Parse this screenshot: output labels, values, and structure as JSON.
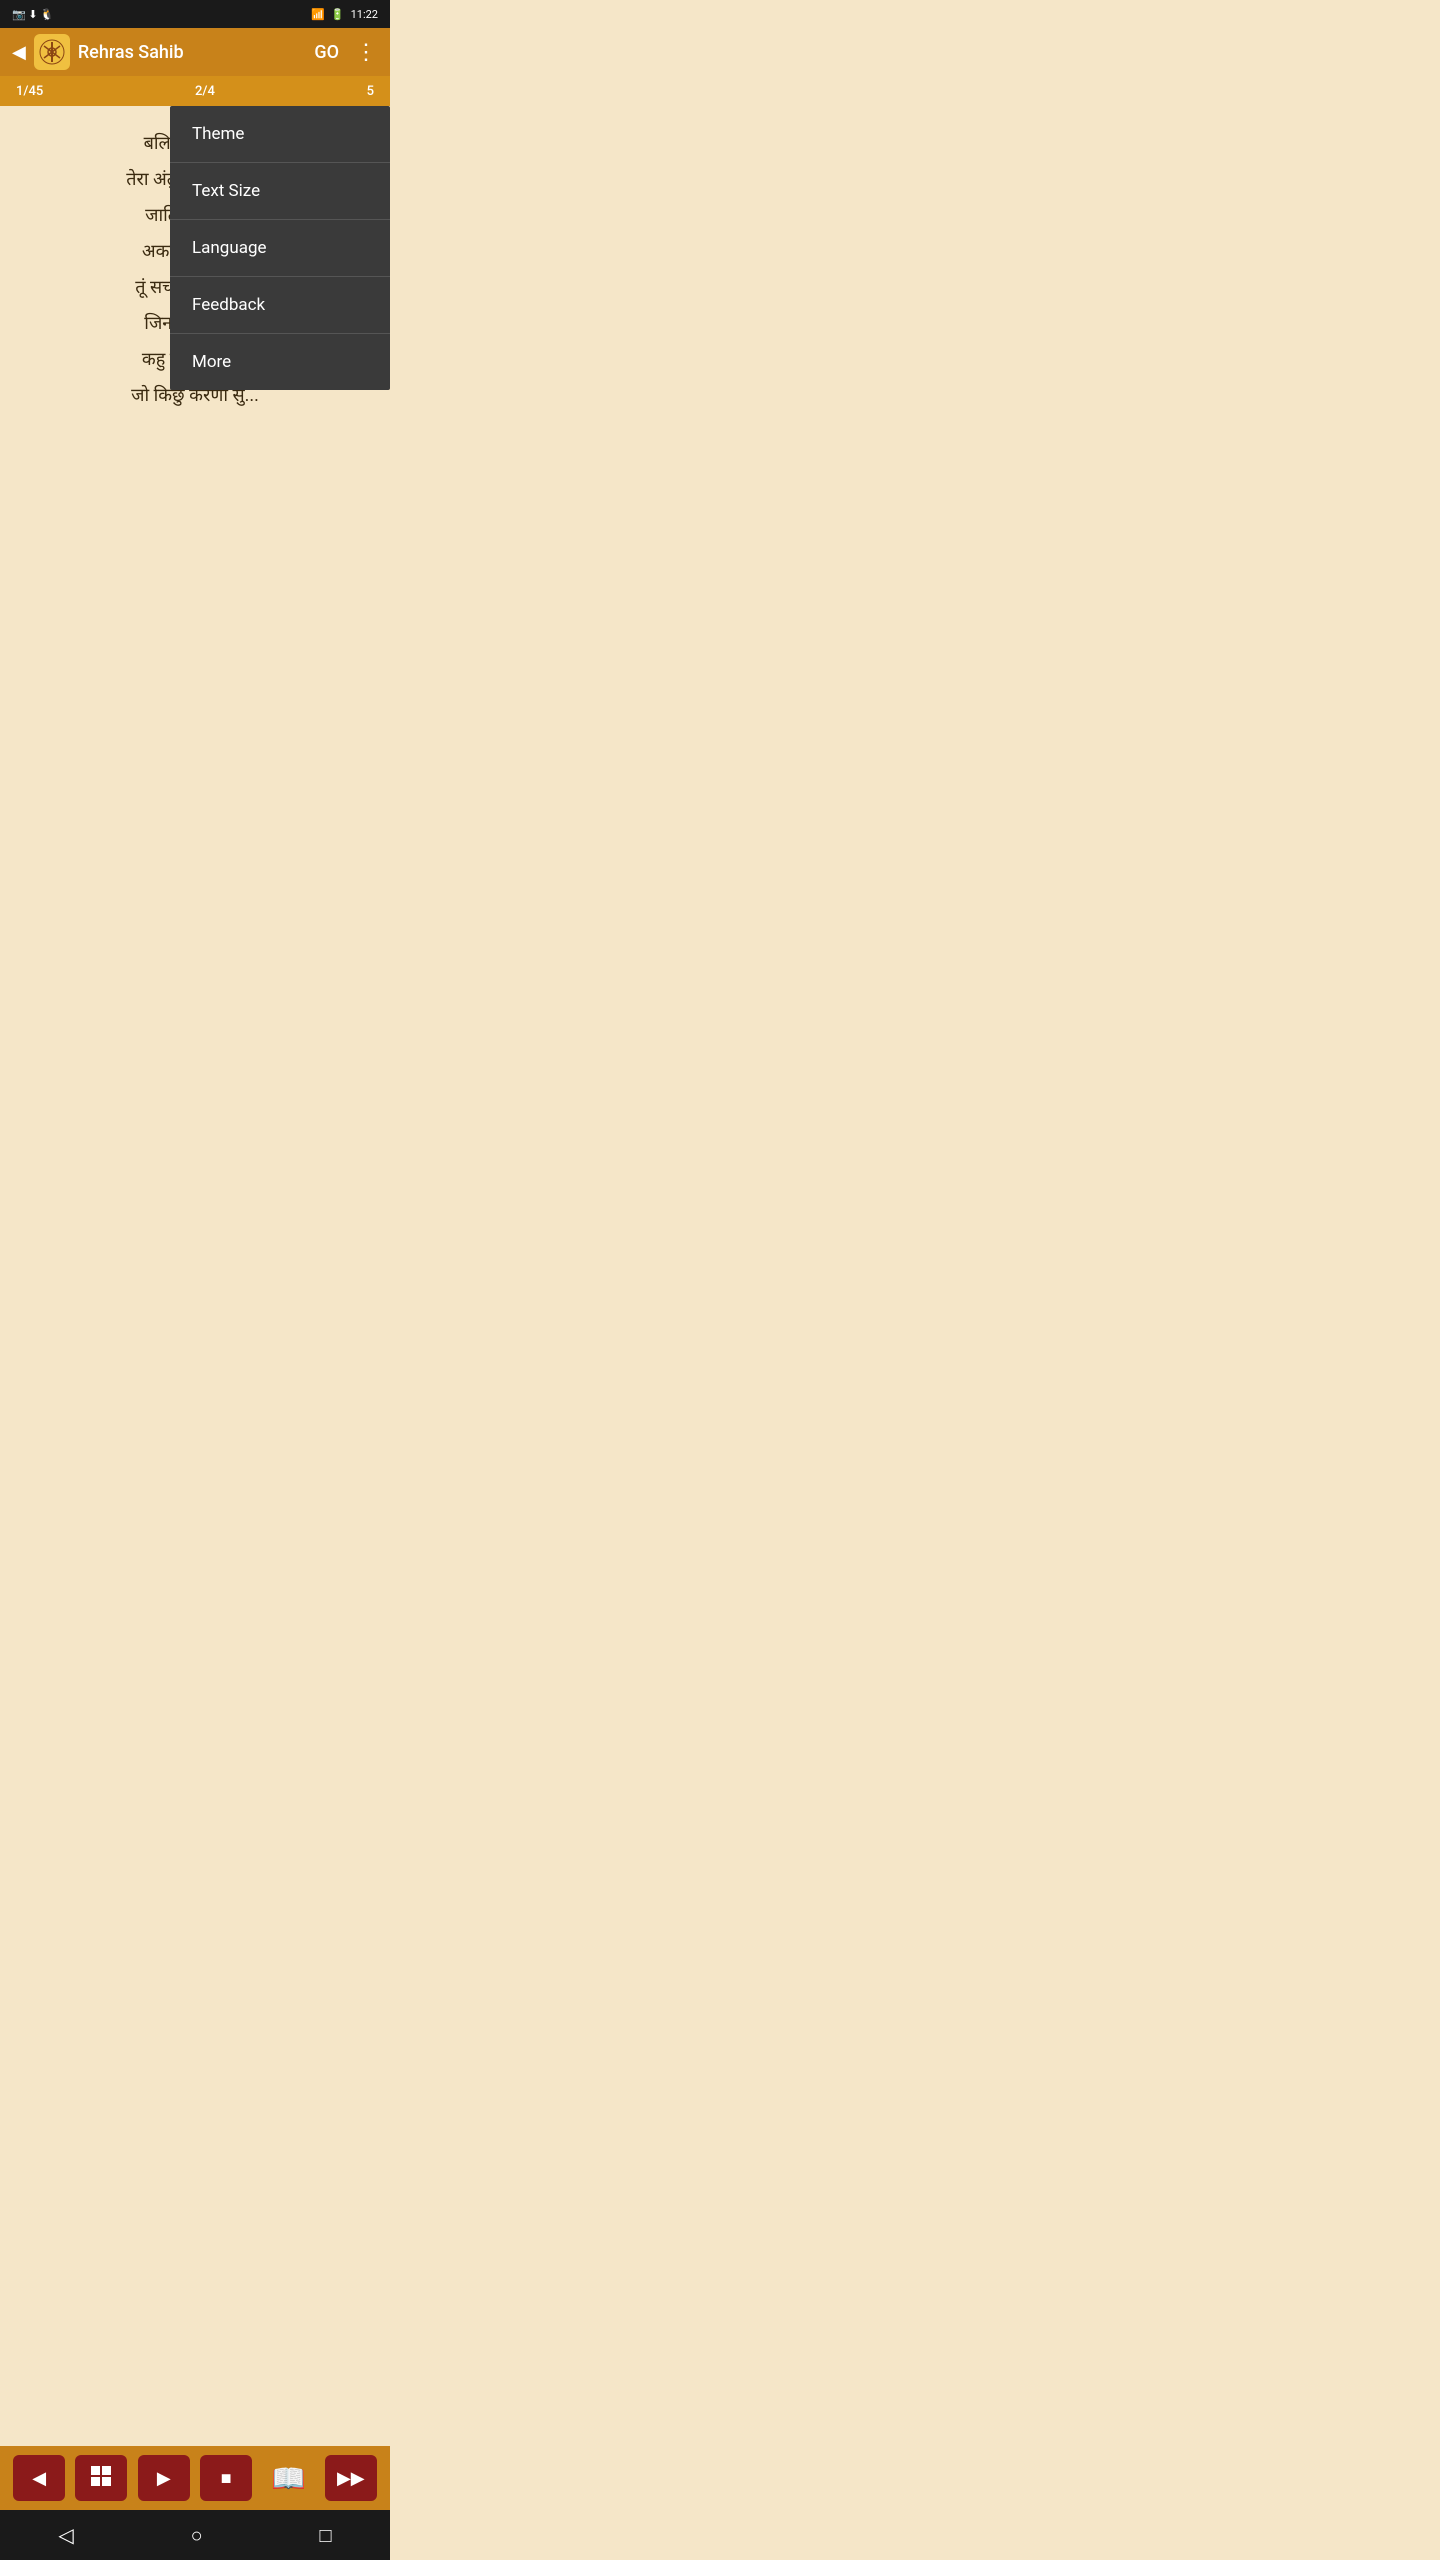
{
  "statusBar": {
    "time": "11:22",
    "icons": [
      "signal",
      "battery"
    ]
  },
  "appBar": {
    "title": "Rehras Sahib",
    "goLabel": "GO",
    "backIcon": "◀",
    "moreIcon": "⋮"
  },
  "pagination": {
    "left": "1/45",
    "middle": "2/4",
    "right": "5"
  },
  "content": {
    "lines": [
      "बलिहारी कुदर...",
      "तेरा अंतु न जाड़ी लि...",
      "जाति महि जोति",
      "अकल कला भ...",
      "तूं सचा साहिबु रि...",
      "जिन कीती सो...",
      "कहु नानक कर...",
      "जो किछु करणा सु..."
    ]
  },
  "menu": {
    "items": [
      {
        "id": "theme",
        "label": "Theme"
      },
      {
        "id": "text-size",
        "label": "Text Size"
      },
      {
        "id": "language",
        "label": "Language"
      },
      {
        "id": "feedback",
        "label": "Feedback"
      },
      {
        "id": "more",
        "label": "More"
      }
    ]
  },
  "bottomBar": {
    "prevIcon": "◀",
    "gridIcon": "⊞",
    "playIcon": "▶",
    "stopIcon": "■",
    "bookIcon": "📖",
    "nextIcon": "▶▶"
  },
  "androidNav": {
    "backIcon": "◁",
    "homeIcon": "○",
    "recentIcon": "□"
  }
}
